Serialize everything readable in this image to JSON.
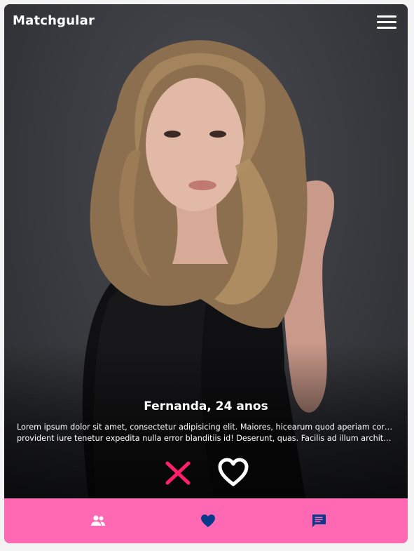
{
  "app": {
    "title": "Matchgular"
  },
  "header": {
    "menu_icon": "hamburger-menu-icon"
  },
  "profile": {
    "name_age": "Fernanda, 24 anos",
    "bio_line1": "Lorem ipsum dolor sit amet, consectetur adipisicing elit. Maiores, hicearum quod aperiam corporis ad",
    "bio_line2": "provident iure tenetur expedita nulla error blanditiis id! Deserunt, quas. Facilis ad illum architecto..."
  },
  "actions": {
    "dislike_icon": "x-icon",
    "like_icon": "heart-outline-icon"
  },
  "bottom_nav": {
    "items": [
      {
        "icon": "people-icon"
      },
      {
        "icon": "heart-icon"
      },
      {
        "icon": "chat-icon"
      }
    ]
  },
  "colors": {
    "nav_background": "#ff69b4",
    "nav_icon_people": "#ffffff",
    "nav_icon_heart": "#0b3a8c",
    "nav_icon_chat": "#0b3a8c",
    "dislike": "#ff1f6b",
    "like": "#ffffff"
  }
}
